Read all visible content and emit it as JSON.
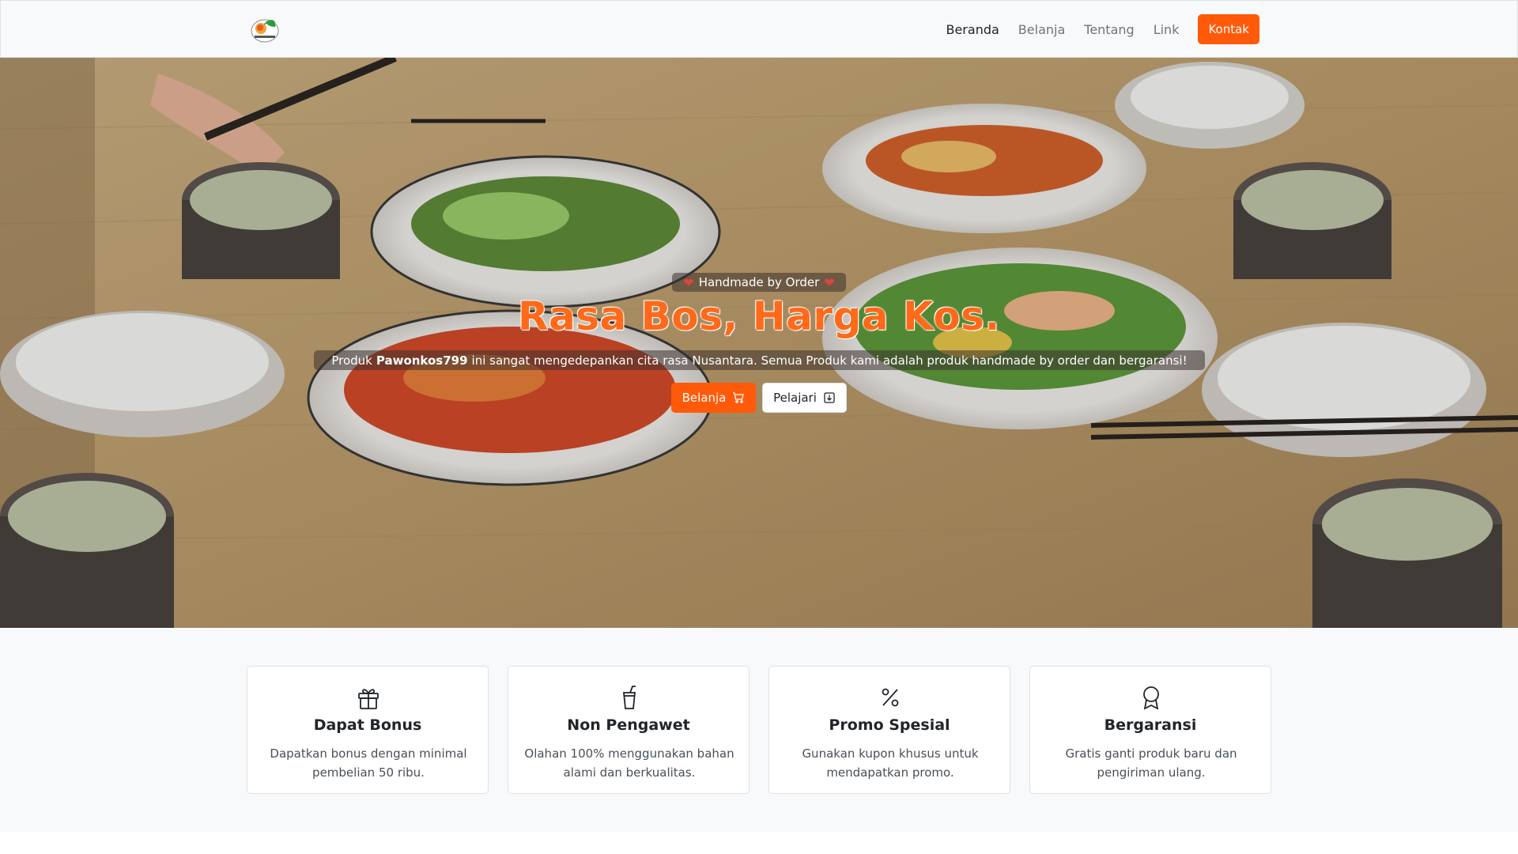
{
  "navbar": {
    "links": [
      {
        "label": "Beranda"
      },
      {
        "label": "Belanja"
      },
      {
        "label": "Tentang"
      },
      {
        "label": "Link"
      }
    ],
    "cta_label": "Kontak"
  },
  "hero": {
    "badge": "Handmade by Order",
    "title": "Rasa Bos, Harga Kos.",
    "desc_pre": "Produk",
    "desc_brand": "Pawonkos799",
    "desc_post": "ini sangat mengedepankan cita rasa Nusantara. Semua Produk kami adalah produk handmade by order dan bergaransi!",
    "btn_primary": "Belanja",
    "btn_secondary": "Pelajari"
  },
  "features": [
    {
      "icon": "gift-icon",
      "title": "Dapat Bonus",
      "text": "Dapatkan bonus dengan minimal pembelian 50 ribu."
    },
    {
      "icon": "cup-icon",
      "title": "Non Pengawet",
      "text": "Olahan 100% menggunakan bahan alami dan berkualitas."
    },
    {
      "icon": "percent-icon",
      "title": "Promo Spesial",
      "text": "Gunakan kupon khusus untuk mendapatkan promo."
    },
    {
      "icon": "award-icon",
      "title": "Bergaransi",
      "text": "Gratis ganti produk baru dan pengiriman ulang."
    }
  ],
  "colors": {
    "accent": "#ff5a0a",
    "navbar_bg": "#f8f9fa"
  }
}
